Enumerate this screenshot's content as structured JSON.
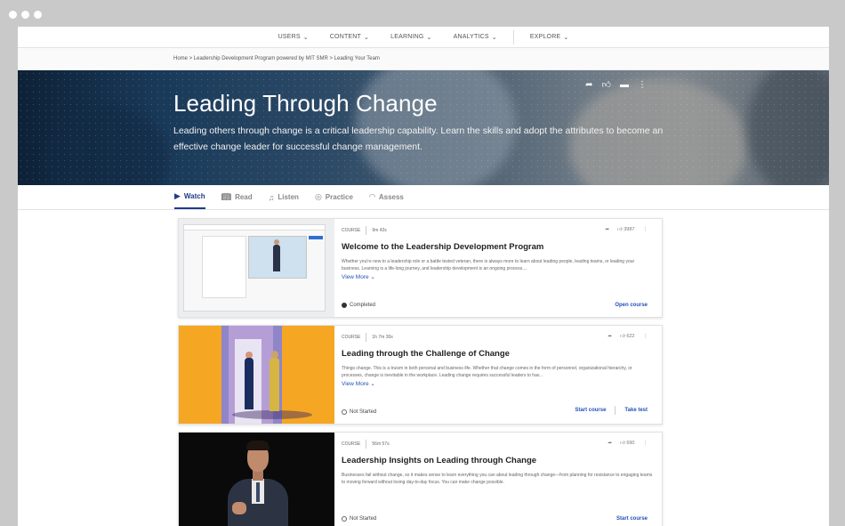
{
  "nav": {
    "items": [
      "USERS",
      "CONTENT",
      "LEARNING",
      "ANALYTICS",
      "EXPLORE"
    ]
  },
  "breadcrumb": "Home > Leadership Development Program powered by MIT SMR > Leading Your Team",
  "hero": {
    "title": "Leading Through Change",
    "description": "Leading others through change is a critical leadership capability. Learn the skills and adopt the attributes to become an effective change leader for successful change management."
  },
  "tabs": [
    {
      "label": "Watch"
    },
    {
      "label": "Read"
    },
    {
      "label": "Listen"
    },
    {
      "label": "Practice"
    },
    {
      "label": "Assess"
    }
  ],
  "cards": [
    {
      "type": "COURSE",
      "duration": "9m 42s",
      "likes": "3987",
      "title": "Welcome to the Leadership Development Program",
      "description": "Whether you're new to a leadership role or a battle tested veteran, there is always more to learn about leading people, leading teams, or leading your business. Learning is a life-long journey, and leadership development is an ongoing process....",
      "view_more": "View More",
      "status": "Completed",
      "actions": [
        "Open course"
      ]
    },
    {
      "type": "COURSE",
      "duration": "1h 7m 30s",
      "likes": "622",
      "title": "Leading through the Challenge of Change",
      "description": "Things change. This is a truism in both personal and business life. Whether that change comes in the form of personnel, organizational hierarchy, or processes, change is inevitable in the workplace. Leading change requires successful leaders to hav...",
      "view_more": "View More",
      "status": "Not Started",
      "actions": [
        "Start course",
        "Take test"
      ]
    },
    {
      "type": "COURSE",
      "duration": "56m 57s",
      "likes": "690",
      "title": "Leadership Insights on Leading through Change",
      "description": "Businesses fail without change, so it makes sense to learn everything you can about leading through change—from planning for resistance to engaging teams to moving forward without losing day-to-day focus. You can make change possible.",
      "view_more": "",
      "status": "Not Started",
      "actions": [
        "Start course"
      ]
    }
  ]
}
